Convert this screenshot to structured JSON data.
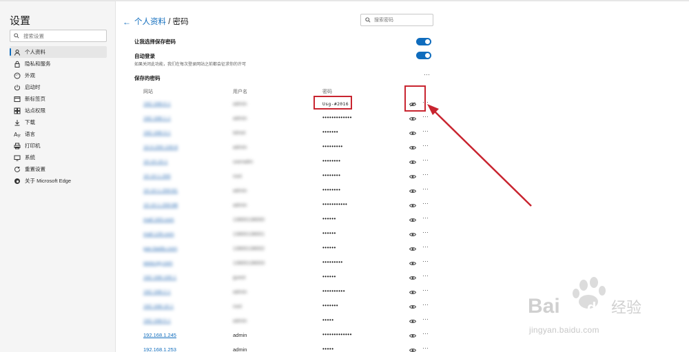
{
  "sidebar": {
    "title": "设置",
    "search_placeholder": "搜索设置",
    "items": [
      {
        "label": "个人资料",
        "icon": "person-icon",
        "active": true
      },
      {
        "label": "隐私和服务",
        "icon": "lock-icon",
        "active": false
      },
      {
        "label": "外观",
        "icon": "palette-icon",
        "active": false
      },
      {
        "label": "启动时",
        "icon": "power-icon",
        "active": false
      },
      {
        "label": "新标签页",
        "icon": "newtab-icon",
        "active": false
      },
      {
        "label": "站点权限",
        "icon": "permissions-icon",
        "active": false
      },
      {
        "label": "下载",
        "icon": "download-icon",
        "active": false
      },
      {
        "label": "语言",
        "icon": "language-icon",
        "active": false
      },
      {
        "label": "打印机",
        "icon": "printer-icon",
        "active": false
      },
      {
        "label": "系统",
        "icon": "system-icon",
        "active": false
      },
      {
        "label": "重置设置",
        "icon": "reset-icon",
        "active": false
      },
      {
        "label": "关于 Microsoft Edge",
        "icon": "edge-icon",
        "active": false
      }
    ]
  },
  "header": {
    "back_icon": "back-arrow-icon",
    "breadcrumb_link": "个人资料",
    "breadcrumb_sep": " / ",
    "breadcrumb_current": "密码",
    "search_placeholder": "搜索密码"
  },
  "settings": {
    "offer_save": {
      "label": "让我选择保存密码",
      "enabled": true
    },
    "auto_signin": {
      "label": "自动登录",
      "desc": "如果关闭此功能，我们在每次登录网站之前都会征求你的许可",
      "enabled": true
    }
  },
  "saved": {
    "title": "保存的密码",
    "more": "···",
    "columns": {
      "site": "网站",
      "user": "用户名",
      "password": "密码"
    },
    "rows": [
      {
        "site": "192.168.0.1",
        "user": "admin",
        "password": "Usg-#2016",
        "revealed": true
      },
      {
        "site": "192.168.1.1",
        "user": "admin",
        "password": "•••••••••••••",
        "revealed": false
      },
      {
        "site": "192.168.3.1",
        "user": "telnet",
        "password": "•••••••",
        "revealed": false
      },
      {
        "site": "10.0.200.100:8",
        "user": "admin",
        "password": "•••••••••",
        "revealed": false
      },
      {
        "site": "10.10.10.1",
        "user": "useradm",
        "password": "••••••••",
        "revealed": false
      },
      {
        "site": "10.10.1.200",
        "user": "root",
        "password": "••••••••",
        "revealed": false
      },
      {
        "site": "10.10.1.200:81",
        "user": "admin",
        "password": "••••••••",
        "revealed": false
      },
      {
        "site": "10.10.1.200:88",
        "user": "admin",
        "password": "•••••••••••",
        "revealed": false
      },
      {
        "site": "mail.163.com",
        "user": "13800138000",
        "password": "••••••",
        "revealed": false
      },
      {
        "site": "mail.126.com",
        "user": "13800138001",
        "password": "••••••",
        "revealed": false
      },
      {
        "site": "pan.baidu.com",
        "user": "13800138002",
        "password": "••••••",
        "revealed": false
      },
      {
        "site": "www.qq.com",
        "user": "13800138003",
        "password": "•••••••••",
        "revealed": false
      },
      {
        "site": "192.168.100.1",
        "user": "guest",
        "password": "••••••",
        "revealed": false
      },
      {
        "site": "192.168.2.1",
        "user": "admin",
        "password": "••••••••••",
        "revealed": false
      },
      {
        "site": "192.168.10.1",
        "user": "root",
        "password": "•••••••",
        "revealed": false
      },
      {
        "site": "192.168.5.1",
        "user": "admin",
        "password": "•••••",
        "revealed": false
      },
      {
        "site": "192.168.1.245",
        "user": "admin",
        "password": "•••••••••••••",
        "revealed": false
      },
      {
        "site": "192.168.1.253",
        "user": "admin",
        "password": "•••••",
        "revealed": false
      }
    ],
    "eye_icon": "show-password-eye-icon",
    "row_more": "···"
  },
  "watermark": {
    "logo": "Bai du 经验",
    "url": "jingyan.baidu.com"
  },
  "colors": {
    "accent": "#0f6cbd",
    "highlight": "#c8242f",
    "sidebar_bg": "#f5f5f5"
  }
}
